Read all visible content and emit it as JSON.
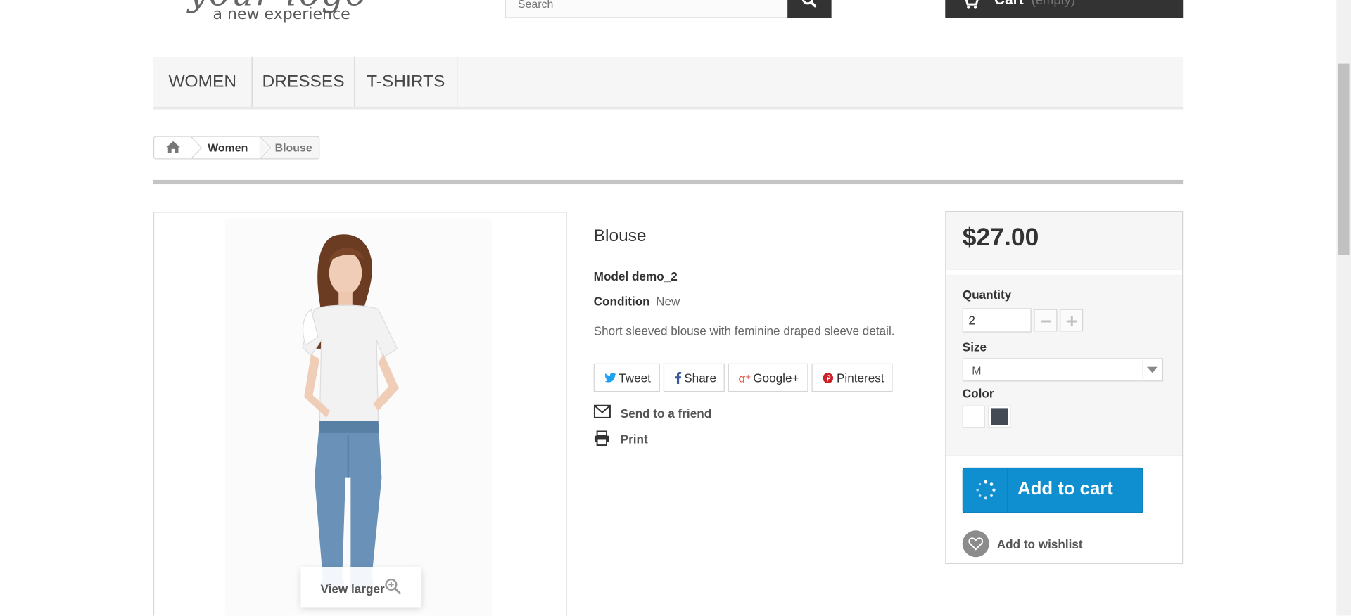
{
  "header": {
    "logo_script": "your logo",
    "logo_tagline": "a new experience",
    "search_placeholder": "Search",
    "cart_label": "Cart",
    "cart_status": "(empty)"
  },
  "menu": {
    "items": [
      {
        "label": "WOMEN"
      },
      {
        "label": "DRESSES"
      },
      {
        "label": "T-SHIRTS"
      }
    ]
  },
  "breadcrumb": {
    "items": [
      {
        "label": "Women"
      },
      {
        "label": "Blouse"
      }
    ]
  },
  "image": {
    "view_larger": "View larger"
  },
  "product": {
    "title": "Blouse",
    "reference": "Model demo_2",
    "condition_label": "Condition",
    "condition_value": "New",
    "short_description": "Short sleeved blouse with feminine draped sleeve detail.",
    "social": [
      {
        "label": "Tweet",
        "icon": "twitter-icon",
        "color": "#1da1f2"
      },
      {
        "label": "Share",
        "icon": "facebook-icon",
        "color": "#3b5998"
      },
      {
        "label": "Google+",
        "icon": "google-plus-icon",
        "color": "#dd4b39"
      },
      {
        "label": "Pinterest",
        "icon": "pinterest-icon",
        "color": "#cb2027"
      }
    ],
    "send_to_friend": "Send to a friend",
    "print": "Print"
  },
  "buy_box": {
    "price": "$27.00",
    "quantity_label": "Quantity",
    "quantity_value": "2",
    "size_label": "Size",
    "size_value": "M",
    "color_label": "Color",
    "colors": [
      {
        "name": "White",
        "hex": "#ffffff"
      },
      {
        "name": "Black",
        "hex": "#434a54"
      }
    ],
    "add_to_cart": "Add to cart",
    "add_to_cart_color": "#0f8ed0",
    "add_to_wishlist": "Add to wishlist"
  }
}
